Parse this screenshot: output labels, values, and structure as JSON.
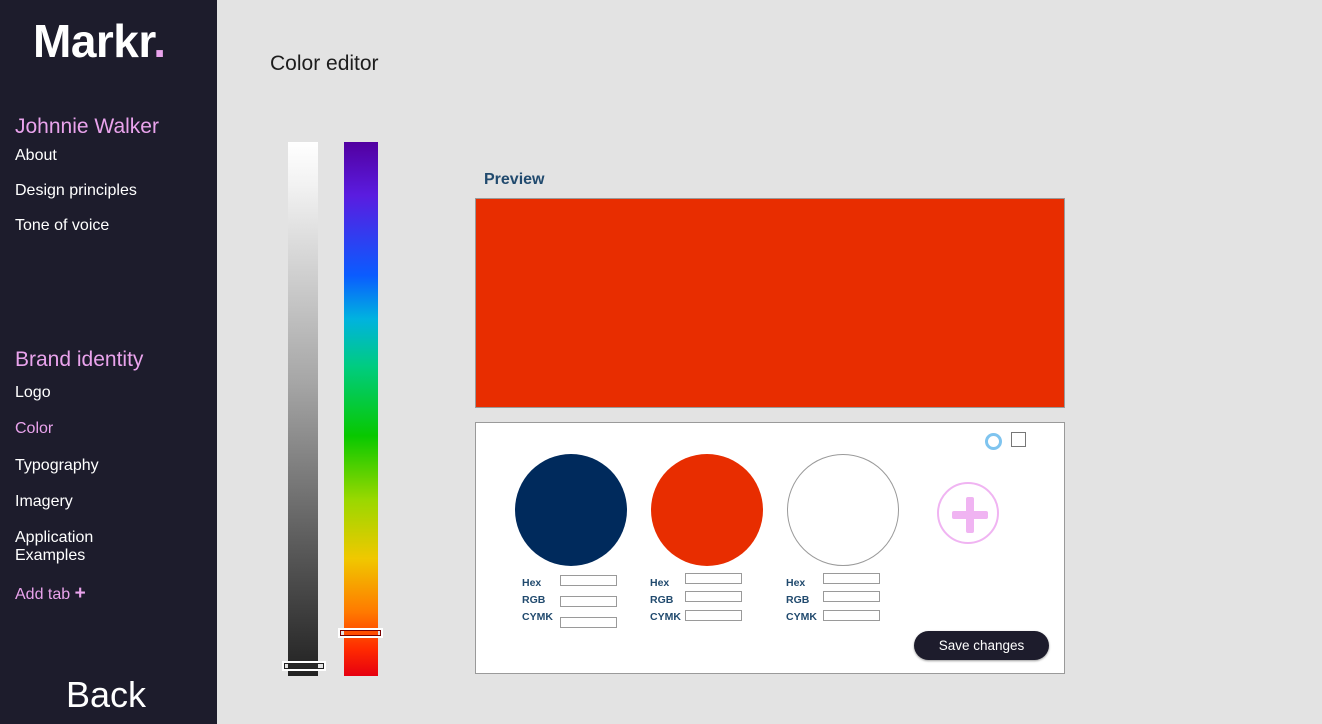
{
  "app": {
    "logo_text": "Markr",
    "logo_dot": "."
  },
  "sidebar": {
    "brand_name": "Johnnie Walker",
    "brand_items": [
      {
        "label": "About"
      },
      {
        "label": "Design principles"
      },
      {
        "label": "Tone of voice"
      }
    ],
    "identity_heading": "Brand identity",
    "identity_items": [
      {
        "label": "Logo",
        "active": false
      },
      {
        "label": "Color",
        "active": true
      },
      {
        "label": "Typography",
        "active": false
      },
      {
        "label": "Imagery",
        "active": false
      },
      {
        "label": "Application Examples",
        "active": false
      }
    ],
    "add_tab_label": "Add tab",
    "add_tab_icon": "+",
    "back_label": "Back"
  },
  "main": {
    "title": "Color editor",
    "preview_label": "Preview",
    "preview_color": "#e82d00",
    "gray_slider_level": 1.0,
    "hue_slider_level": 0.92
  },
  "palette": {
    "shape_options": [
      "circle-icon",
      "square-icon"
    ],
    "swatches": [
      {
        "color": "#002a5c",
        "hex_label": "Hex",
        "rgb_label": "RGB",
        "cmyk_label": "CYMK",
        "hex_value": "",
        "rgb_value": "",
        "cmyk_value": ""
      },
      {
        "color": "#e82d00",
        "hex_label": "Hex",
        "rgb_label": "RGB",
        "cmyk_label": "CYMK",
        "hex_value": "",
        "rgb_value": "",
        "cmyk_value": ""
      },
      {
        "color": "#ffffff",
        "hex_label": "Hex",
        "rgb_label": "RGB",
        "cmyk_label": "CYMK",
        "hex_value": "",
        "rgb_value": "",
        "cmyk_value": ""
      }
    ],
    "add_color_icon": "plus-icon",
    "save_label": "Save changes"
  },
  "colors": {
    "sidebar_bg": "#1d1c2c",
    "accent_pink": "#e9a3ec",
    "label_blue": "#214a6e",
    "page_bg": "#e3e3e3"
  }
}
